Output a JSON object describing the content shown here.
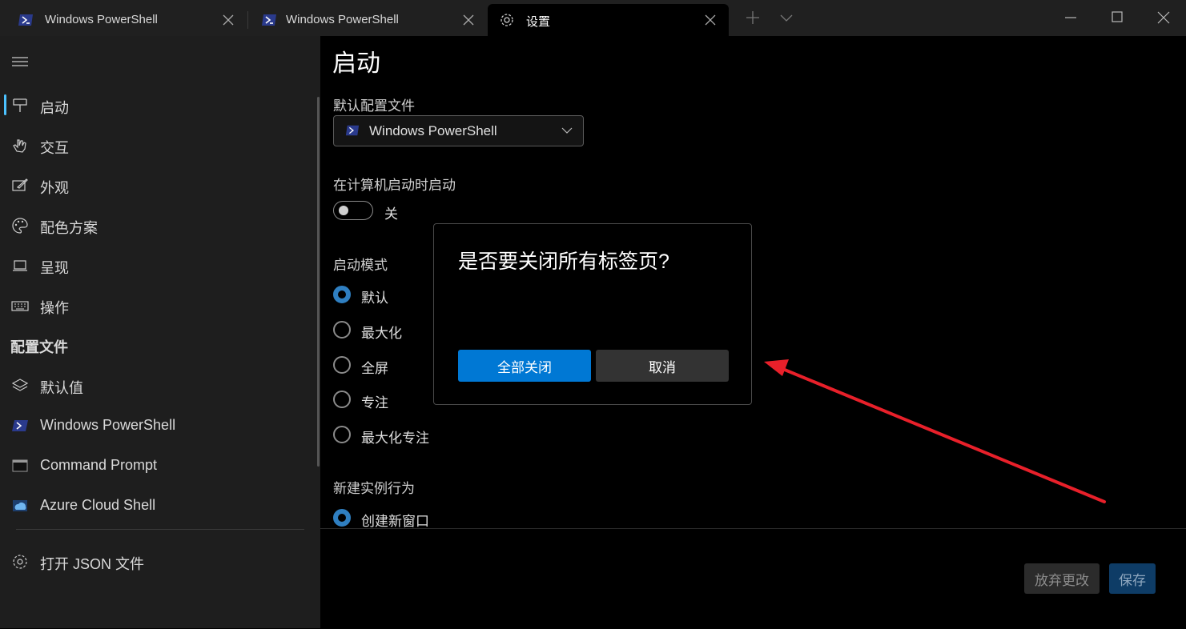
{
  "titlebar": {
    "tabs": [
      {
        "title": "Windows PowerShell",
        "icon": "powershell-icon"
      },
      {
        "title": "Windows PowerShell",
        "icon": "powershell-icon"
      },
      {
        "title": "设置",
        "icon": "gear-icon",
        "active": true
      }
    ],
    "new_tab_icon": "plus-icon",
    "dropdown_icon": "chevron-down-icon",
    "window_controls": [
      "minimize-icon",
      "maximize-icon",
      "close-icon"
    ]
  },
  "sidebar": {
    "menu_icon": "hamburger-icon",
    "items": [
      {
        "label": "启动",
        "icon": "startup-icon",
        "selected": true
      },
      {
        "label": "交互",
        "icon": "hand-icon"
      },
      {
        "label": "外观",
        "icon": "appearance-icon"
      },
      {
        "label": "配色方案",
        "icon": "palette-icon"
      },
      {
        "label": "呈现",
        "icon": "monitor-icon"
      },
      {
        "label": "操作",
        "icon": "keyboard-icon"
      }
    ],
    "profiles_header": "配置文件",
    "profiles": [
      {
        "label": "默认值",
        "icon": "layers-icon"
      },
      {
        "label": "Windows PowerShell",
        "icon": "powershell-icon"
      },
      {
        "label": "Command Prompt",
        "icon": "cmd-icon"
      },
      {
        "label": "Azure Cloud Shell",
        "icon": "azure-icon"
      }
    ],
    "open_json": {
      "label": "打开 JSON 文件",
      "icon": "gear-icon"
    }
  },
  "content": {
    "title": "启动",
    "default_profile": {
      "label": "默认配置文件",
      "value": "Windows PowerShell"
    },
    "launch_on_startup": {
      "label": "在计算机启动时启动",
      "state": "关",
      "on": false
    },
    "launch_mode": {
      "label": "启动模式",
      "options": [
        "默认",
        "最大化",
        "全屏",
        "专注",
        "最大化专注"
      ],
      "selected": "默认"
    },
    "new_instance": {
      "label": "新建实例行为",
      "options": [
        "创建新窗口"
      ],
      "selected": "创建新窗口"
    }
  },
  "footer": {
    "discard_label": "放弃更改",
    "save_label": "保存"
  },
  "dialog": {
    "title": "是否要关闭所有标签页?",
    "primary_label": "全部关闭",
    "cancel_label": "取消"
  },
  "colors": {
    "accent": "#0078d4",
    "annotation_arrow": "#e8202a",
    "sidebar_bg": "#1e1e1e",
    "titlebar_bg": "#202020"
  }
}
